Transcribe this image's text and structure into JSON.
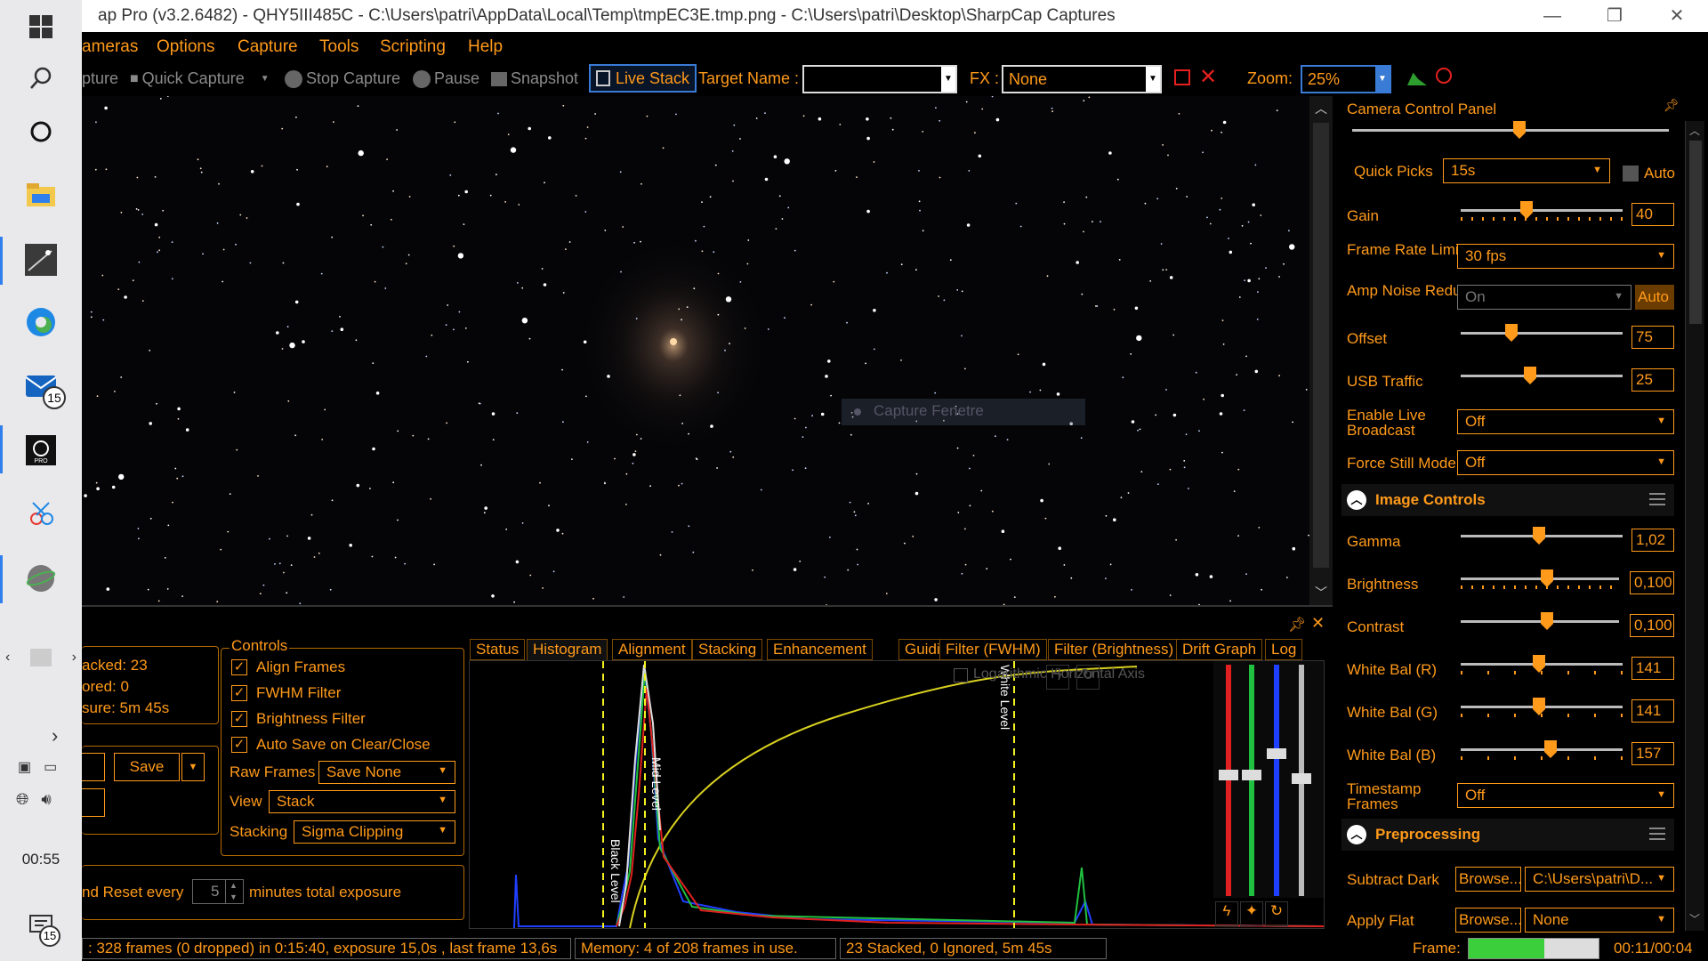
{
  "window": {
    "title": "ap Pro (v3.2.6482) - QHY5III485C - C:\\Users\\patri\\AppData\\Local\\Temp\\tmpEC3E.tmp.png - C:\\Users\\patri\\Desktop\\SharpCap Captures",
    "controls": [
      "—",
      "❐",
      "✕"
    ]
  },
  "taskbar": {
    "mail_badge": "15",
    "clock": "00:55",
    "notification_badge": "15"
  },
  "menu": [
    "ameras",
    "Options",
    "Capture",
    "Tools",
    "Scripting",
    "Help"
  ],
  "toolbar": {
    "capture": "pture",
    "quick_capture": "Quick Capture",
    "stop_capture": "Stop Capture",
    "pause": "Pause",
    "snapshot": "Snapshot",
    "live_stack": "Live Stack",
    "target_name_label": "Target Name :",
    "target_name_value": "",
    "fx_label": "FX :",
    "fx_value": "None",
    "zoom_label": "Zoom:",
    "zoom_value": "25%"
  },
  "image": {
    "overlay_text": "Capture Fenetre"
  },
  "stack_summary": {
    "stacked": "acked: 23",
    "ignored": "ored:  0",
    "exposure": "sure:  5m 45s",
    "save_label": "Save",
    "reset_prefix": "nd Reset every",
    "reset_value": "5",
    "reset_suffix": "minutes total exposure"
  },
  "controls_group": {
    "title": "Controls",
    "checkboxes": [
      {
        "label": "Align Frames",
        "checked": true
      },
      {
        "label": "FWHM Filter",
        "checked": true
      },
      {
        "label": "Brightness Filter",
        "checked": true
      },
      {
        "label": "Auto Save on Clear/Close",
        "checked": true
      }
    ],
    "raw_frames_label": "Raw Frames",
    "raw_frames_value": "Save None",
    "view_label": "View",
    "view_value": "Stack",
    "stacking_label": "Stacking",
    "stacking_value": "Sigma Clipping"
  },
  "tabs": [
    "Status",
    "Histogram",
    "Alignment",
    "Stacking",
    "Enhancement",
    "Guiding",
    "Filter (FWHM)",
    "Filter (Brightness)",
    "Drift Graph",
    "Log"
  ],
  "active_tab": "Histogram",
  "histogram": {
    "log_axis_label": "Logarithmic Horizontal Axis",
    "black_level_label": "Black Level",
    "mid_level_label": "Mid Level",
    "white_level_label": "White Level",
    "log_axis_checked": false
  },
  "camera_panel": {
    "title": "Camera Control Panel",
    "quick_picks_label": "Quick Picks",
    "quick_picks_value": "15s",
    "auto_label": "Auto",
    "exposure_slider_level": 0.53,
    "rows": [
      {
        "label": "Gain",
        "value": "40",
        "level": 0.4
      },
      {
        "label": "Offset",
        "value": "75",
        "level": 0.3
      },
      {
        "label": "USB Traffic",
        "value": "25",
        "level": 0.42
      }
    ],
    "frame_rate_label": "Frame Rate Limit",
    "frame_rate_value": "30 fps",
    "amp_noise_label": "Amp Noise Reduction",
    "amp_noise_value": "On",
    "amp_noise_auto": "Auto",
    "live_broadcast_label": "Enable Live Broadcast",
    "live_broadcast_value": "Off",
    "force_still_label": "Force Still Mode",
    "force_still_value": "Off"
  },
  "image_controls": {
    "title": "Image Controls",
    "rows": [
      {
        "label": "Gamma",
        "value": "1,02",
        "level": 0.48
      },
      {
        "label": "Brightness",
        "value": "0,100",
        "level": 0.55
      },
      {
        "label": "Contrast",
        "value": "0,100",
        "level": 0.55
      },
      {
        "label": "White Bal (R)",
        "value": "141",
        "level": 0.48
      },
      {
        "label": "White Bal (G)",
        "value": "141",
        "level": 0.48
      },
      {
        "label": "White Bal (B)",
        "value": "157",
        "level": 0.56
      }
    ],
    "timestamp_label": "Timestamp Frames",
    "timestamp_value": "Off"
  },
  "preprocessing": {
    "title": "Preprocessing",
    "subtract_dark_label": "Subtract Dark",
    "browse_label": "Browse...",
    "dark_value": "C:\\Users\\patri\\D...",
    "apply_flat_label": "Apply Flat",
    "flat_value": "None"
  },
  "status": {
    "frames": ": 328 frames (0 dropped) in 0:15:40, exposure 15,0s , last frame 13,6s",
    "memory": "Memory: 4 of 208 frames in use.",
    "stacked": "23 Stacked, 0 Ignored, 5m 45s",
    "frame_label": "Frame:",
    "frame_progress": 0.58,
    "frame_time": "00:11/00:04"
  },
  "colors": {
    "accent": "#ff9a1a",
    "background": "#000000",
    "live_stack_border": "#3a7bd5",
    "progress": "#3ccf3c"
  }
}
